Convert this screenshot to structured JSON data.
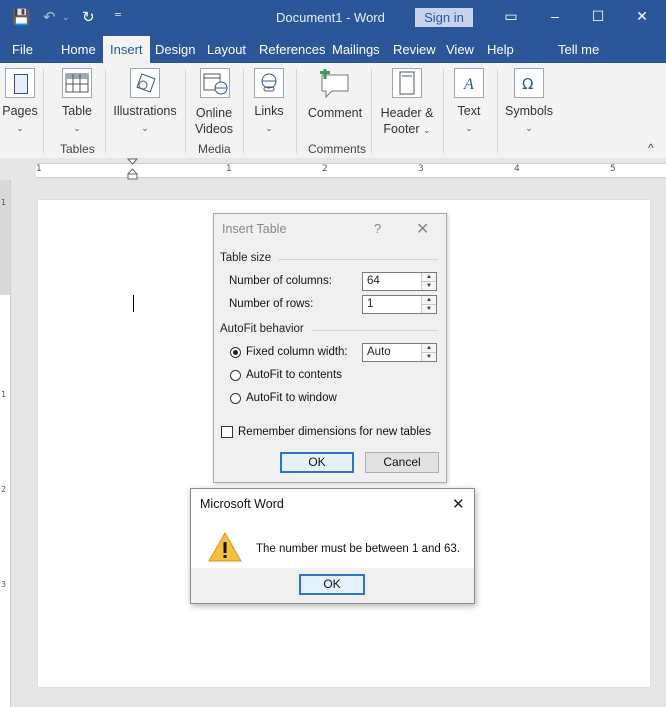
{
  "titlebar": {
    "doc_title": "Document1  -  Word",
    "sign_in": "Sign in",
    "save_glyph": "💾",
    "undo_glyph": "↶",
    "redo_glyph": "↻",
    "customize_glyph": "⁼",
    "ribbon_opts_glyph": "▭",
    "minimize_glyph": "–",
    "maximize_glyph": "☐",
    "close_glyph": "✕"
  },
  "tabs": [
    "File",
    "Home",
    "Insert",
    "Design",
    "Layout",
    "References",
    "Mailings",
    "Review",
    "View",
    "Help",
    "Tell me"
  ],
  "tell_me_icon": "lightbulb-icon",
  "ribbon": {
    "buttons": [
      {
        "label": "Pages",
        "icon": "pages-icon"
      },
      {
        "label": "Table",
        "icon": "table-icon"
      },
      {
        "label": "Illustrations",
        "icon": "illustrations-icon"
      },
      {
        "label": "Online",
        "label2": "Videos",
        "icon": "online-video-icon"
      },
      {
        "label": "Links",
        "icon": "links-icon"
      },
      {
        "label": "Comment",
        "icon": "comment-icon"
      },
      {
        "label": "Header &",
        "label2": "Footer",
        "icon": "header-footer-icon"
      },
      {
        "label": "Text",
        "icon": "text-icon"
      },
      {
        "label": "Symbols",
        "icon": "symbols-icon"
      }
    ],
    "groups": [
      "Tables",
      "Media",
      "Comments"
    ],
    "collapse_glyph": "^"
  },
  "ruler": {
    "numbers": [
      "1",
      "1",
      "2",
      "3",
      "4",
      "5"
    ],
    "vnumbers": [
      "1",
      "1",
      "2",
      "3"
    ]
  },
  "insert_table": {
    "title": "Insert Table",
    "help": "?",
    "close": "✕",
    "table_size_label": "Table size",
    "columns_label": "Number of columns:",
    "columns_value": "64",
    "rows_label": "Number of rows:",
    "rows_value": "1",
    "autofit_label": "AutoFit behavior",
    "fixed_label": "Fixed column width:",
    "fixed_value": "Auto",
    "contents_label": "AutoFit to contents",
    "window_label": "AutoFit to window",
    "selected_option": "Fixed column width:",
    "remember_label": "Remember dimensions for new tables",
    "remember_checked": false,
    "ok": "OK",
    "cancel": "Cancel"
  },
  "message_box": {
    "title": "Microsoft Word",
    "close": "✕",
    "message": "The number must be between 1 and 63.",
    "ok": "OK",
    "icon": "warning-icon"
  },
  "colors": {
    "accent": "#2b579a",
    "warning": "#f6c23e"
  }
}
